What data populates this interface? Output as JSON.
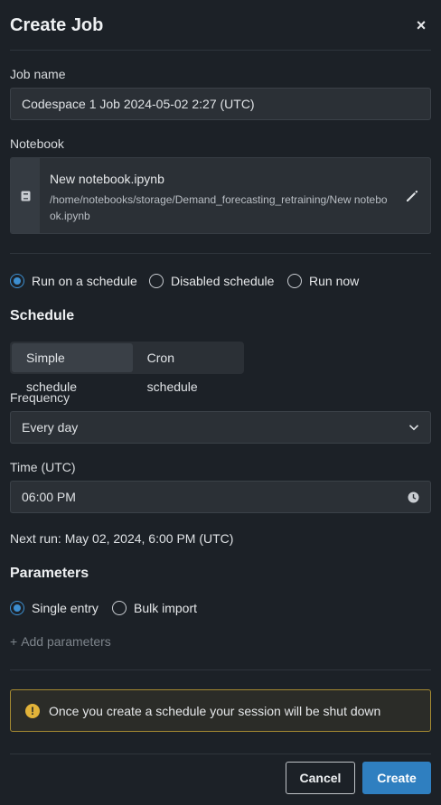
{
  "dialog": {
    "title": "Create Job",
    "close_glyph": "×"
  },
  "job_name": {
    "label": "Job name",
    "value": "Codespace 1 Job 2024-05-02 2:27 (UTC)"
  },
  "notebook": {
    "label": "Notebook",
    "name": "New notebook.ipynb",
    "path": "/home/notebooks/storage/Demand_forecasting_retraining/New notebook.ipynb",
    "icon": "notebook-icon",
    "edit_icon": "pencil-icon"
  },
  "run_mode": {
    "options": [
      {
        "label": "Run on a schedule",
        "selected": true
      },
      {
        "label": "Disabled schedule",
        "selected": false
      },
      {
        "label": "Run now",
        "selected": false
      }
    ]
  },
  "schedule": {
    "heading": "Schedule",
    "tabs": [
      {
        "label": "Simple schedule",
        "active": true
      },
      {
        "label": "Cron schedule",
        "active": false
      }
    ],
    "frequency_label": "Frequency",
    "frequency_value": "Every day",
    "time_label": "Time (UTC)",
    "time_value": "06:00 PM",
    "next_run": "Next run: May 02, 2024, 6:00 PM (UTC)"
  },
  "parameters": {
    "heading": "Parameters",
    "options": [
      {
        "label": "Single entry",
        "selected": true
      },
      {
        "label": "Bulk import",
        "selected": false
      }
    ],
    "add_label": "Add parameters",
    "add_glyph": "+"
  },
  "warning": {
    "glyph": "!",
    "text": "Once you create a schedule your session will be shut down"
  },
  "footer": {
    "cancel_label": "Cancel",
    "create_label": "Create"
  },
  "colors": {
    "background": "#1c2127",
    "accent": "#3d8fd1",
    "primary_button": "#2f7fc0",
    "warning": "#e2b339"
  }
}
